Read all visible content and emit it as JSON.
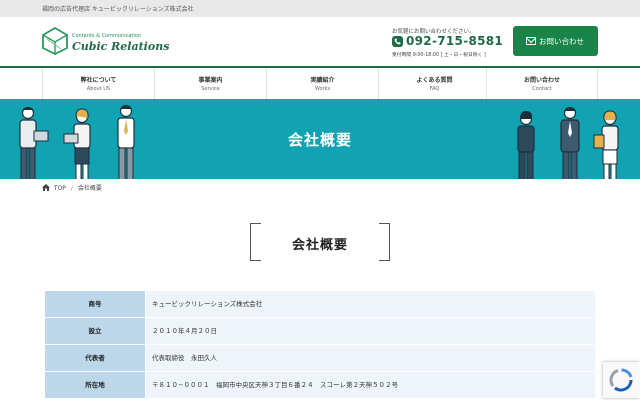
{
  "topbar": {
    "tagline": "福岡の広告代理店 キュービックリレーションズ株式会社"
  },
  "header": {
    "logo_small": "Contents & Communication",
    "logo_big": "Cubic Relations",
    "contact_lead": "お気軽にお問い合わせください。",
    "phone": "092-715-8581",
    "hours": "受付時間 9:00-18:00 [ 土・日・祝日除く ]",
    "contact_button": "お問い合わせ"
  },
  "nav": [
    {
      "jp": "弊社について",
      "en": "About US"
    },
    {
      "jp": "事業案内",
      "en": "Service"
    },
    {
      "jp": "実績紹介",
      "en": "Works"
    },
    {
      "jp": "よくある質問",
      "en": "FAQ"
    },
    {
      "jp": "お問い合わせ",
      "en": "Contact"
    }
  ],
  "hero": {
    "title": "会社概要"
  },
  "breadcrumb": {
    "home": "TOP",
    "current": "会社概要"
  },
  "section": {
    "title": "会社概要"
  },
  "company_table": [
    {
      "label": "商号",
      "value": "キュービックリレーションズ株式会社"
    },
    {
      "label": "設立",
      "value": "２０１０年４月２０日"
    },
    {
      "label": "代表者",
      "value": "代表取締役　永田久人"
    },
    {
      "label": "所在地",
      "value": "〒８１０−０００１　福岡市中央区天神３丁目６番２４　スコーレ第２天神５０２号"
    }
  ],
  "colors": {
    "brand_green": "#1f6b45",
    "button_green": "#1a8348",
    "hero_teal": "#12a3b3",
    "table_header": "#bcd7ea",
    "table_cell": "#eef4f9"
  },
  "icons": [
    "logo-cube-icon",
    "phone-icon",
    "mail-icon",
    "home-icon",
    "recaptcha-icon"
  ]
}
